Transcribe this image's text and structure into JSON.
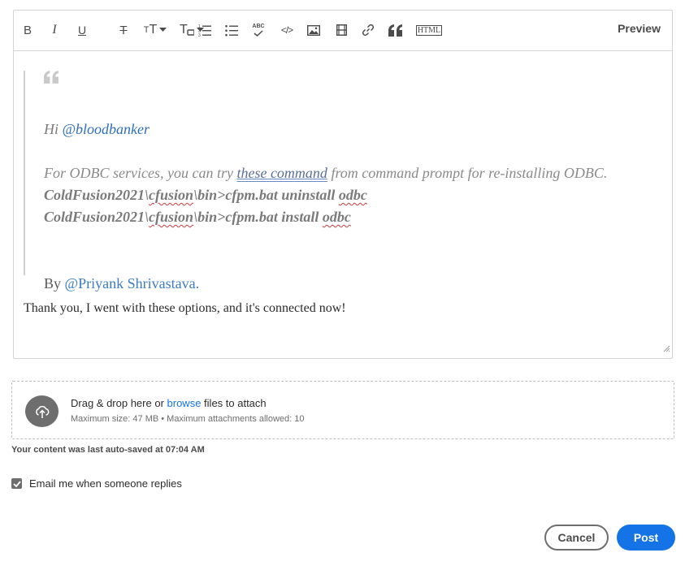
{
  "toolbar": {
    "buttons": [
      {
        "name": "bold-icon",
        "glyph": "B"
      },
      {
        "name": "italic-icon",
        "glyph": "I"
      },
      {
        "name": "underline-icon",
        "glyph": "U"
      },
      {
        "name": "strikethrough-icon",
        "glyph": "T"
      },
      {
        "name": "font-size-icon",
        "glyph": "T"
      },
      {
        "name": "text-format-icon",
        "glyph": "T"
      },
      {
        "name": "numbered-list-icon"
      },
      {
        "name": "bulleted-list-icon"
      },
      {
        "name": "spellcheck-icon",
        "glyph": "ABC"
      },
      {
        "name": "code-icon",
        "glyph": "</>"
      },
      {
        "name": "image-icon"
      },
      {
        "name": "video-icon"
      },
      {
        "name": "link-icon"
      },
      {
        "name": "quote-icon"
      },
      {
        "name": "html-icon",
        "glyph": "HTML"
      }
    ],
    "preview_label": "Preview"
  },
  "editor": {
    "quote": {
      "hi_prefix": "Hi ",
      "hi_mention": "@bloodbanker",
      "odbc_before": "For ODBC services, you can try ",
      "odbc_link": "these command",
      "odbc_after": " from command prompt for re-installing ODBC.",
      "cmd1_a": "ColdFusion2021\\",
      "cmd1_b": "cfusion",
      "cmd1_c": "\\bin>cfpm.bat uninstall ",
      "cmd1_d": "odbc",
      "cmd2_a": "ColdFusion2021\\",
      "cmd2_b": "cfusion",
      "cmd2_c": "\\bin>cfpm.bat install ",
      "cmd2_d": "odbc",
      "by_prefix": "By ",
      "by_mention": "@Priyank Shrivastava."
    },
    "reply_text": "Thank you, I went with these options, and it's connected now!"
  },
  "attachments": {
    "main_before": "Drag & drop here or ",
    "browse_label": "browse",
    "main_after": " files to attach",
    "sub_text": "Maximum size: 47 MB • Maximum attachments allowed: 10"
  },
  "autosave_text": "Your content was last auto-saved at 07:04 AM",
  "email_option": {
    "label": "Email me when someone replies",
    "checked": true
  },
  "actions": {
    "cancel_label": "Cancel",
    "post_label": "Post"
  },
  "colors": {
    "accent": "#1473e6",
    "mention": "#2e6fb8",
    "icon_gray": "#4b4b4b"
  }
}
